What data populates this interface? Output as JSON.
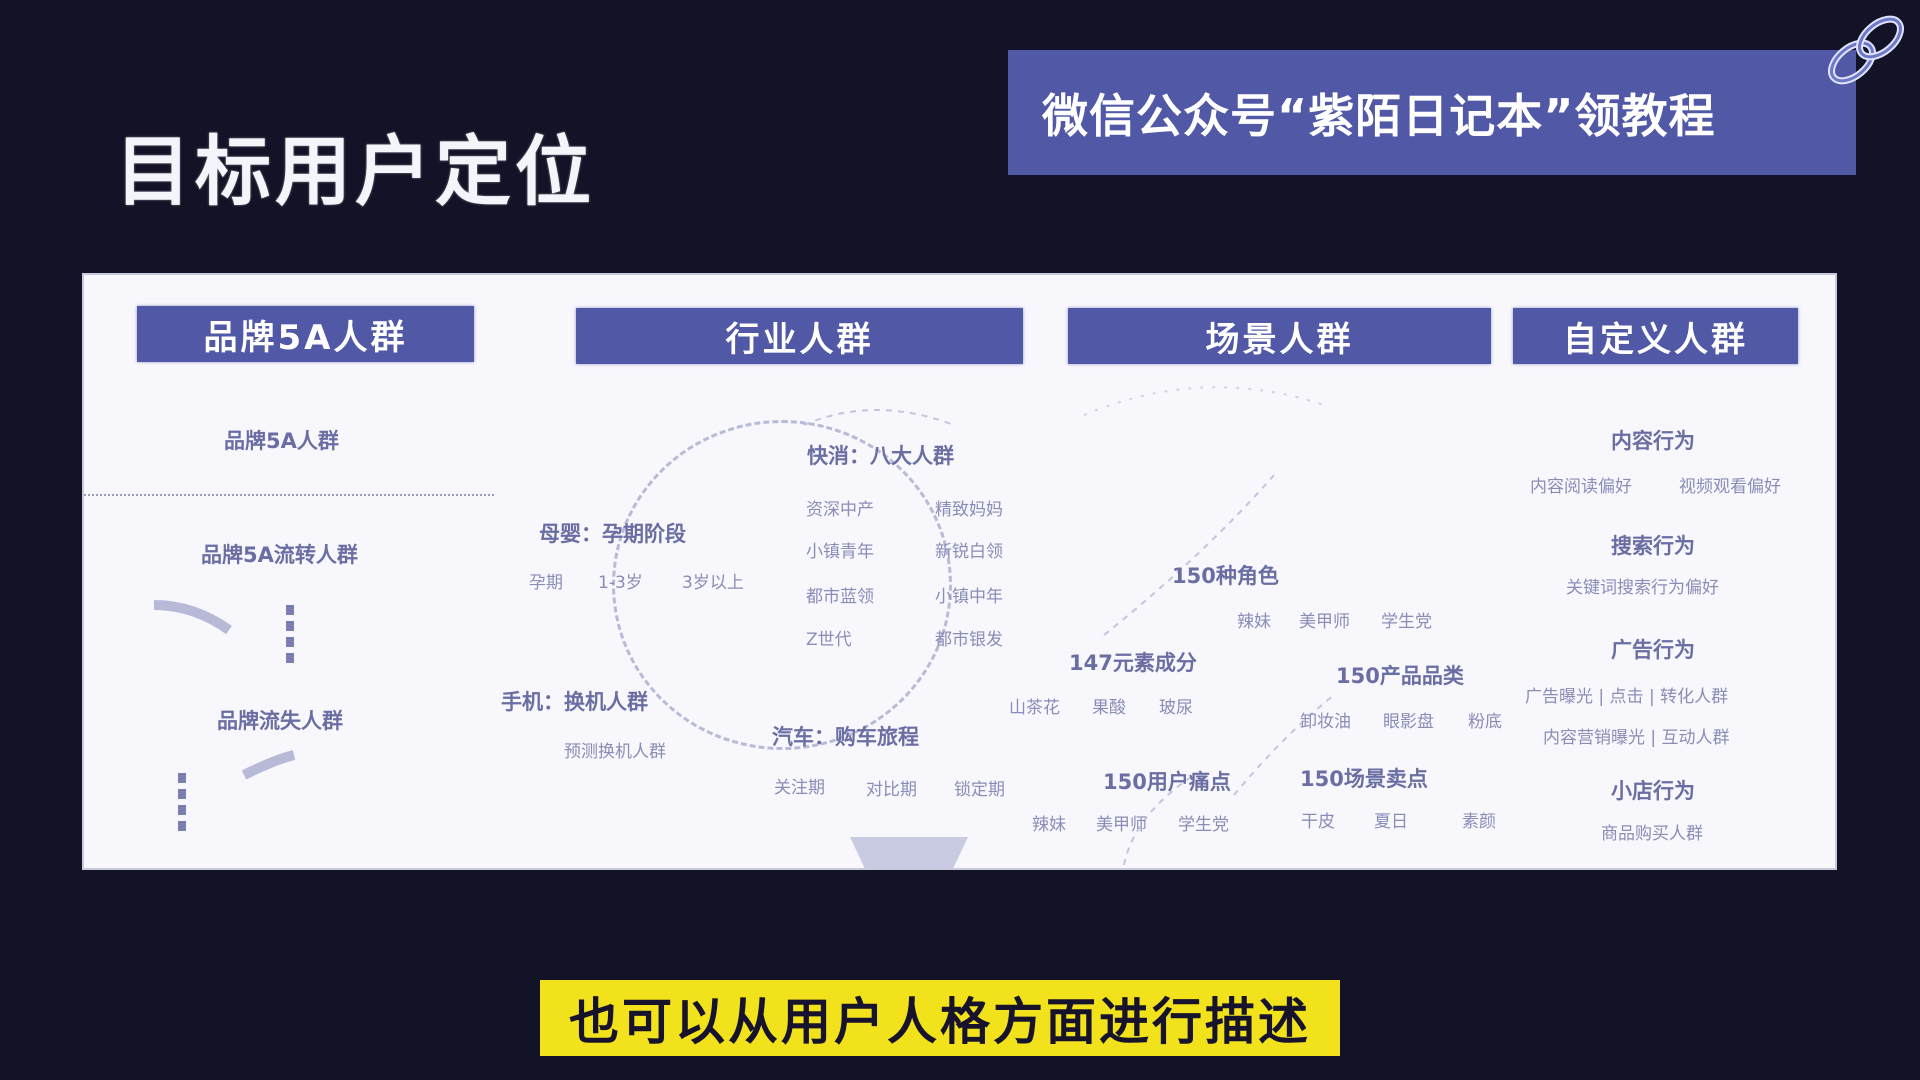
{
  "page": {
    "title": "目标用户定位",
    "banner": "微信公众号“紫陌日记本”领教程",
    "caption": "也可以从用户人格方面进行描述"
  },
  "colors": {
    "background": "#131327",
    "accent": "#5158a6",
    "panel": "#f7f7fc",
    "caption_bg": "#f1e21c"
  },
  "icons": [
    "chain-link-icon"
  ],
  "columns": [
    {
      "header": "品牌5A人群"
    },
    {
      "header": "行业人群"
    },
    {
      "header": "场景人群"
    },
    {
      "header": "自定义人群"
    }
  ],
  "brand5a": {
    "section1": "品牌5A人群",
    "section2": "品牌5A流转人群",
    "section3": "品牌流失人群"
  },
  "industry": {
    "fmcg_title": "快消：八大人群",
    "fmcg_items": [
      "资深中产",
      "精致妈妈",
      "小镇青年",
      "新锐白领",
      "都市蓝领",
      "小镇中年",
      "Z世代",
      "都市银发"
    ],
    "maternal_title": "母婴：孕期阶段",
    "maternal_items": [
      "孕期",
      "1-3岁",
      "3岁以上"
    ],
    "phone_title": "手机：换机人群",
    "phone_items": [
      "预测换机人群"
    ],
    "auto_title": "汽车：购车旅程",
    "auto_items": [
      "关注期",
      "对比期",
      "锁定期"
    ]
  },
  "scene": {
    "roles_title": "150种角色",
    "roles_items": [
      "辣妹",
      "美甲师",
      "学生党"
    ],
    "ingredients_title": "147元素成分",
    "ingredients_items": [
      "山茶花",
      "果酸",
      "玻尿"
    ],
    "category_title": "150产品品类",
    "category_items": [
      "卸妆油",
      "眼影盘",
      "粉底"
    ],
    "painpoint_title": "150用户痛点",
    "painpoint_items": [
      "辣妹",
      "美甲师",
      "学生党"
    ],
    "sellpoint_title": "150场景卖点",
    "sellpoint_items": [
      "干皮",
      "夏日",
      "素颜"
    ]
  },
  "custom": {
    "content_title": "内容行为",
    "content_items": [
      "内容阅读偏好",
      "视频观看偏好"
    ],
    "search_title": "搜索行为",
    "search_items": [
      "关键词搜索行为偏好"
    ],
    "ad_title": "广告行为",
    "ad_items_1": "广告曝光 | 点击 | 转化人群",
    "ad_items_2": "内容营销曝光 | 互动人群",
    "shop_title": "小店行为",
    "shop_items": [
      "商品购买人群"
    ]
  }
}
